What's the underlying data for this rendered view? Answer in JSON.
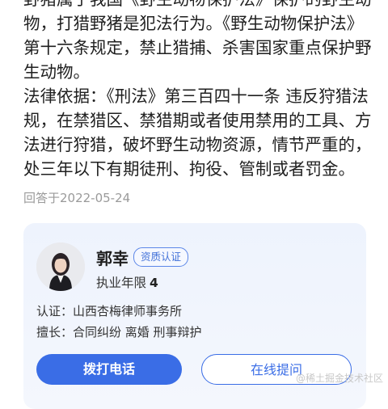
{
  "answer": {
    "paragraphs": [
      "野猪属于我国《野生动物保护法》保护的野生动物，打猎野猪是犯法行为。《野生动物保护法》第十六条规定，禁止猎捕、杀害国家重点保护野生动物。",
      "法律依据：《刑法》第三百四十一条 违反狩猎法规，在禁猎区、禁猎期或者使用禁用的工具、方法进行狩猎，破坏野生动物资源，情节严重的，处三年以下有期徒刑、拘役、管制或者罚金。"
    ],
    "date": "回答于2022-05-24"
  },
  "lawyer": {
    "name": "郭幸",
    "badge": "资质认证",
    "years_label": "执业年限",
    "years_value": "4",
    "cert_label": "认证：",
    "cert_value": "山西杏梅律师事务所",
    "skill_label": "擅长：",
    "skill_value": "合同纠纷 离婚 刑事辩护",
    "call_button": "拨打电话",
    "ask_button": "在线提问"
  },
  "watermark": "@稀土掘金技术社区",
  "colors": {
    "accent": "#3a6de6",
    "card_bg": "#eef3fd",
    "muted": "#9a9a9a"
  }
}
